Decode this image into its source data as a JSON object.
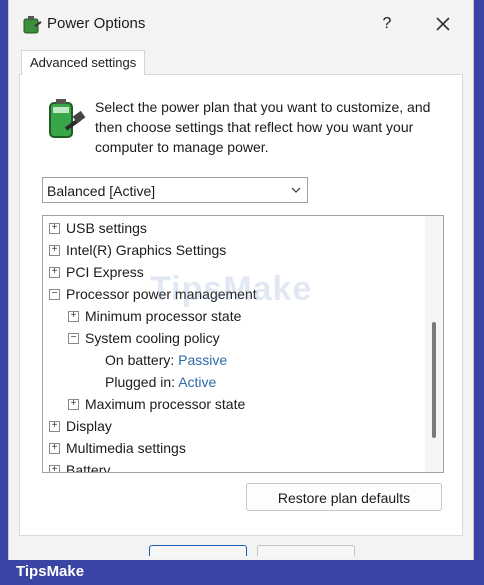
{
  "window": {
    "title": "Power Options",
    "help_label": "?",
    "tab_label": "Advanced settings"
  },
  "description": "Select the power plan that you want to customize, and then choose settings that reflect how you want your computer to manage power.",
  "plan_select": {
    "value": "Balanced [Active]"
  },
  "tree": {
    "items": [
      {
        "label": "USB settings",
        "expander": "+",
        "level": 0
      },
      {
        "label": "Intel(R) Graphics Settings",
        "expander": "+",
        "level": 0
      },
      {
        "label": "PCI Express",
        "expander": "+",
        "level": 0
      },
      {
        "label": "Processor power management",
        "expander": "−",
        "level": 0
      },
      {
        "label": "Minimum processor state",
        "expander": "+",
        "level": 1
      },
      {
        "label": "System cooling policy",
        "expander": "−",
        "level": 1
      },
      {
        "label": "On battery:",
        "value": "Passive",
        "level": 2
      },
      {
        "label": "Plugged in:",
        "value": "Active",
        "level": 2
      },
      {
        "label": "Maximum processor state",
        "expander": "+",
        "level": 1
      },
      {
        "label": "Display",
        "expander": "+",
        "level": 0
      },
      {
        "label": "Multimedia settings",
        "expander": "+",
        "level": 0
      },
      {
        "label": "Battery",
        "expander": "+",
        "level": 0
      }
    ]
  },
  "buttons": {
    "restore": "Restore plan defaults"
  },
  "brand": {
    "name": "TipsMake",
    "watermark": "TipsMake"
  },
  "colors": {
    "accent": "#1a5fb4",
    "link": "#2c6aa8",
    "brand_bar": "#3a44a4"
  }
}
